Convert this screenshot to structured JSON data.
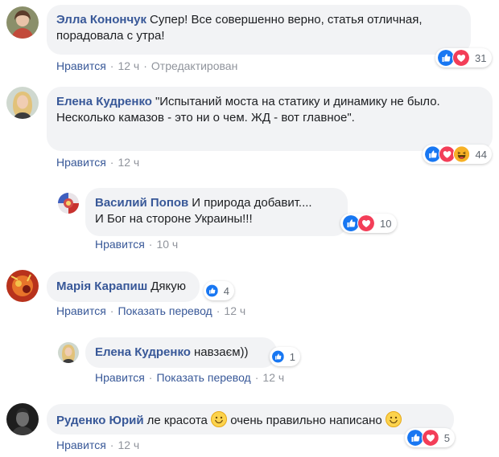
{
  "comments": [
    {
      "author": "Элла Конончук",
      "text": "Супер! Все совершенно верно, статья отличная, порадовала с утра!",
      "like": "Нравится",
      "time": "12 ч",
      "edited": "Отредактирован",
      "reaction_count": "31",
      "reactions": [
        "like-icon",
        "love-icon"
      ]
    },
    {
      "author": "Елена Кудренко",
      "text_line1": "\"Испытаний моста на статику и динамику не было.",
      "text_line2": "Несколько камазов - это ни о чем. ЖД - вот главное\".",
      "like": "Нравится",
      "time": "12 ч",
      "reaction_count": "44",
      "reactions": [
        "like-icon",
        "love-icon",
        "haha-icon"
      ]
    },
    {
      "author": "Василий Попов",
      "text_line1": "И природа добавит....",
      "text_line2": "И Бог на стороне Украины!!!",
      "like": "Нравится",
      "time": "10 ч",
      "reaction_count": "10",
      "reactions": [
        "like-icon",
        "love-icon"
      ]
    },
    {
      "author": "Марія Карапиш",
      "text": "Дякую",
      "like": "Нравится",
      "translate": "Показать перевод",
      "time": "12 ч",
      "reaction_count": "4",
      "reactions": [
        "like-icon"
      ]
    },
    {
      "author": "Елена Кудренко",
      "text": "навзаєм))",
      "like": "Нравится",
      "translate": "Показать перевод",
      "time": "12 ч",
      "reaction_count": "1",
      "reactions": [
        "like-icon"
      ]
    },
    {
      "author": "Руденко Юрий",
      "text_part1": "ле красота",
      "text_part2": "очень правильно написано",
      "like": "Нравится",
      "time": "12 ч",
      "reaction_count": "5",
      "reactions": [
        "like-icon",
        "love-icon"
      ]
    }
  ],
  "colors": {
    "author": "#385898",
    "bubble": "#f2f3f5",
    "meta": "#90949c",
    "like_blue": "#1877f2",
    "love_red": "#f33e58",
    "haha_yellow": "#f7b125"
  }
}
